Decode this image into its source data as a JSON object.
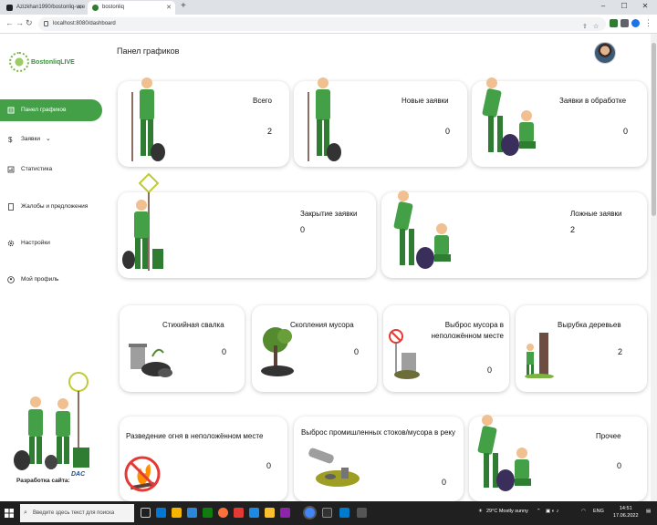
{
  "browser": {
    "tabs": [
      {
        "title": "Azizkhan1990/bostonliq-vue"
      },
      {
        "title": "bostonliq"
      }
    ],
    "url": "localhost:8080/dashboard"
  },
  "app": {
    "logo_text": "BostonliqLIVE",
    "page_title": "Панел графиков"
  },
  "sidebar": {
    "items": [
      {
        "label": "Панел графиков"
      },
      {
        "label": "Заявки"
      },
      {
        "label": "Статистика"
      },
      {
        "label": "Жалобы и предложения"
      },
      {
        "label": "Настройки"
      },
      {
        "label": "Мой профиль"
      }
    ],
    "developer_label": "Разработка сайта:",
    "developer_logo": "DAC"
  },
  "stats": [
    {
      "title": "Всего",
      "value": "2"
    },
    {
      "title": "Новые заявки",
      "value": "0"
    },
    {
      "title": "Заявки в обработке",
      "value": "0"
    },
    {
      "title": "Закрытие заявки",
      "value": "0"
    },
    {
      "title": "Ложные заявки",
      "value": "2"
    }
  ],
  "categories": [
    {
      "title": "Стихийная свалка",
      "value": "0"
    },
    {
      "title": "Скопления мусора",
      "value": "0"
    },
    {
      "title": "Выброс мусора в неположённом месте",
      "value": "0"
    },
    {
      "title": "Вырубка деревьев",
      "value": "2"
    },
    {
      "title": "Разведение огня в неположённом месте",
      "value": "0"
    },
    {
      "title": "Выброс промишленных стоков/мусора в реку",
      "value": "0"
    },
    {
      "title": "Прочее",
      "value": "0"
    }
  ],
  "taskbar": {
    "search_placeholder": "Введите здесь текст для поиска",
    "weather": "29°C  Mostly sunny",
    "language": "ENG",
    "time": "14:51",
    "date": "17.06.2022"
  },
  "colors": {
    "accent": "#43a047",
    "taskbar": "#202020"
  }
}
